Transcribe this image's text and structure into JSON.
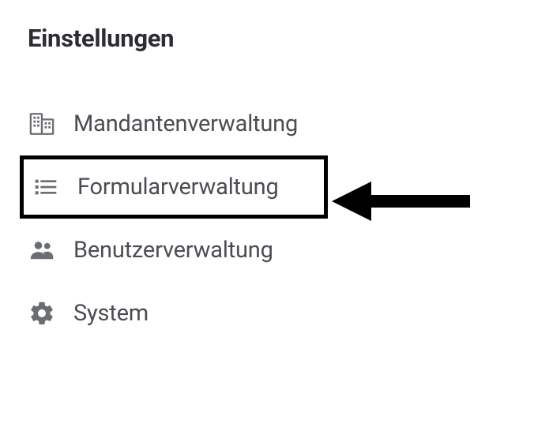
{
  "title": "Einstellungen",
  "menu": {
    "items": [
      {
        "label": "Mandantenverwaltung",
        "icon": "building-icon",
        "highlighted": false
      },
      {
        "label": "Formularverwaltung",
        "icon": "list-icon",
        "highlighted": true
      },
      {
        "label": "Benutzerverwaltung",
        "icon": "users-icon",
        "highlighted": false
      },
      {
        "label": "System",
        "icon": "gear-icon",
        "highlighted": false
      }
    ]
  }
}
